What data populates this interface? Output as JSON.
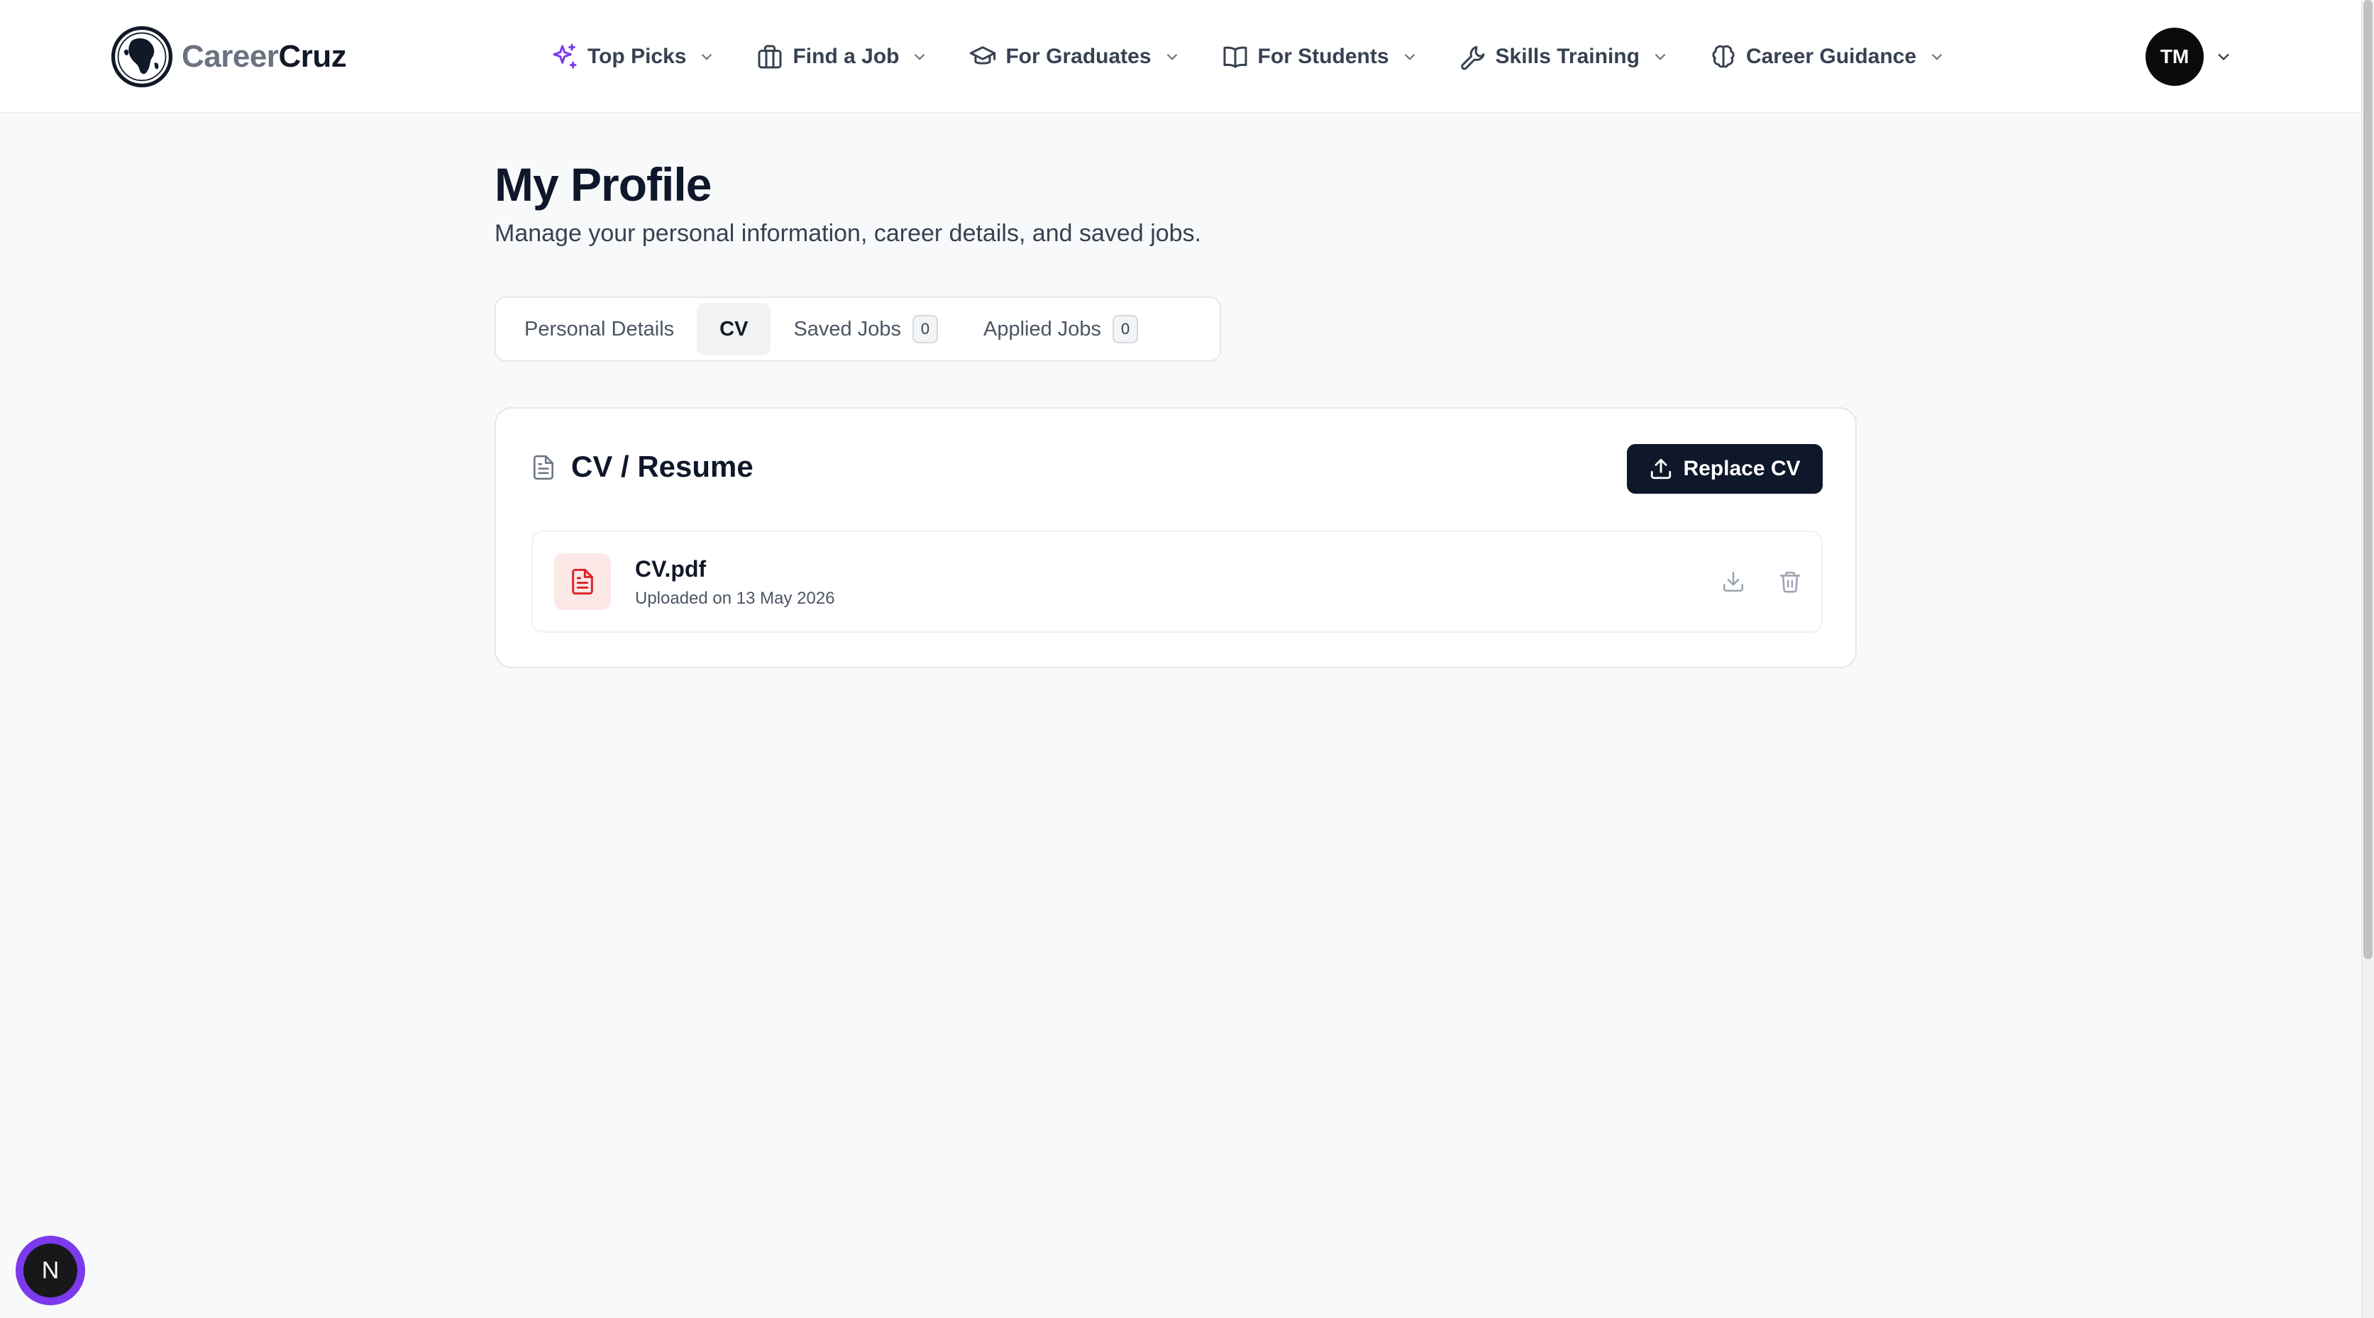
{
  "brand": {
    "part1": "Career",
    "part2": "Cruz"
  },
  "nav": [
    {
      "label": "Top Picks",
      "icon": "sparkles-icon"
    },
    {
      "label": "Find a Job",
      "icon": "briefcase-icon"
    },
    {
      "label": "For Graduates",
      "icon": "graduation-cap-icon"
    },
    {
      "label": "For Students",
      "icon": "book-open-icon"
    },
    {
      "label": "Skills Training",
      "icon": "wrench-icon"
    },
    {
      "label": "Career Guidance",
      "icon": "brain-icon"
    }
  ],
  "user": {
    "initials": "TM"
  },
  "page": {
    "title": "My Profile",
    "subtitle": "Manage your personal information, career details, and saved jobs."
  },
  "tabs": [
    {
      "label": "Personal Details",
      "active": false
    },
    {
      "label": "CV",
      "active": true
    },
    {
      "label": "Saved Jobs",
      "count": "0",
      "active": false
    },
    {
      "label": "Applied Jobs",
      "count": "0",
      "active": false
    }
  ],
  "cv_card": {
    "title": "CV / Resume",
    "replace_label": "Replace CV",
    "file": {
      "name": "CV.pdf",
      "meta": "Uploaded on 13 May 2026"
    }
  },
  "fab": {
    "letter": "N"
  },
  "colors": {
    "primary": "#0f172a",
    "accent_purple": "#7c3aed",
    "file_badge_bg": "#fde8e8",
    "file_icon": "#dc2626",
    "background": "#f8f9fa"
  }
}
